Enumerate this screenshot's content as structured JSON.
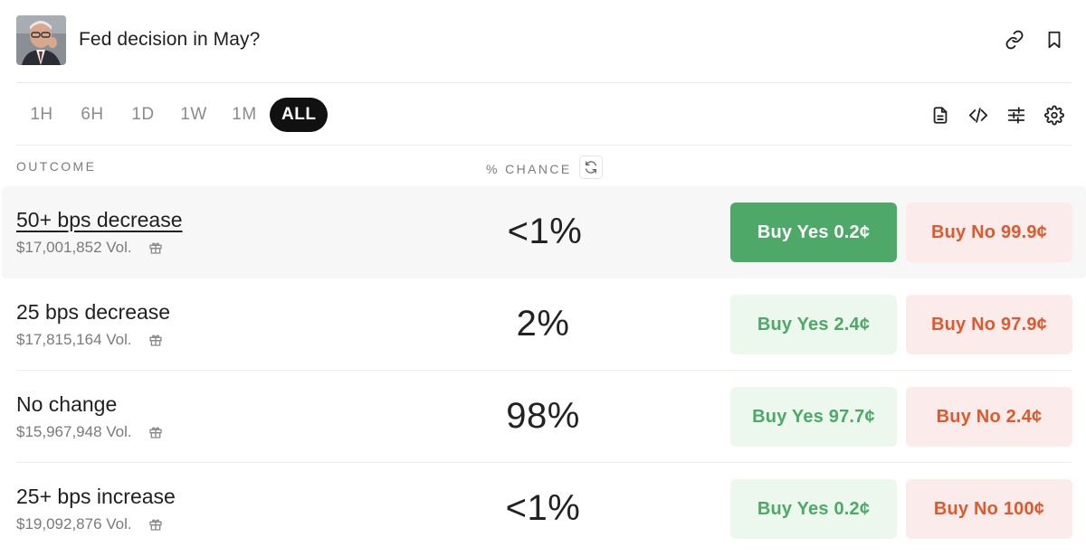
{
  "market": {
    "title": "Fed decision in May?"
  },
  "header_icons": [
    "link-icon",
    "bookmark-icon"
  ],
  "time_ranges": [
    {
      "label": "1H",
      "active": false
    },
    {
      "label": "6H",
      "active": false
    },
    {
      "label": "1D",
      "active": false
    },
    {
      "label": "1W",
      "active": false
    },
    {
      "label": "1M",
      "active": false
    },
    {
      "label": "ALL",
      "active": true
    }
  ],
  "toolbar_icons": [
    "document-icon",
    "code-icon",
    "sliders-icon",
    "gear-icon"
  ],
  "columns": {
    "outcome": "OUTCOME",
    "chance": "% CHANCE"
  },
  "outcomes": [
    {
      "name": "50+ bps decrease",
      "volume": "$17,001,852 Vol.",
      "chance": "<1%",
      "buy_yes": "Buy Yes 0.2¢",
      "buy_no": "Buy No 99.9¢",
      "selected": true
    },
    {
      "name": "25 bps decrease",
      "volume": "$17,815,164 Vol.",
      "chance": "2%",
      "buy_yes": "Buy Yes 2.4¢",
      "buy_no": "Buy No 97.9¢",
      "selected": false
    },
    {
      "name": "No change",
      "volume": "$15,967,948 Vol.",
      "chance": "98%",
      "buy_yes": "Buy Yes 97.7¢",
      "buy_no": "Buy No 2.4¢",
      "selected": false
    },
    {
      "name": "25+ bps increase",
      "volume": "$19,092,876 Vol.",
      "chance": "<1%",
      "buy_yes": "Buy Yes 0.2¢",
      "buy_no": "Buy No 100¢",
      "selected": false
    }
  ],
  "colors": {
    "yes_green": "#4ea867",
    "yes_bg": "#ecf7ee",
    "no_orange": "#dc5a2e",
    "no_bg": "#fbebea",
    "active_tab": "#111111"
  }
}
